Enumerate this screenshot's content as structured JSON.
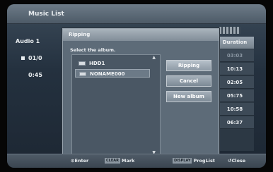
{
  "screen": {
    "title": "Music List"
  },
  "background_list": {
    "album_label": "Audio 1",
    "row1": "01/0",
    "time": "0:45"
  },
  "duration": {
    "header": "Duration",
    "values": [
      "03:03",
      "10:13",
      "02:05",
      "05:75",
      "10:58",
      "06:37"
    ]
  },
  "dialog": {
    "title": "Ripping",
    "prompt": "Select the album.",
    "albums": [
      "HDD1",
      "NONAME000"
    ],
    "buttons": {
      "ripping": "Ripping",
      "cancel": "Cancel",
      "new_album": "New album"
    }
  },
  "help_bar": {
    "enter": "Enter",
    "mark": "Mark",
    "prog_list": "ProgList",
    "close": "Close",
    "mark_key": "CLEAR",
    "prog_key": "DISPLAY"
  }
}
